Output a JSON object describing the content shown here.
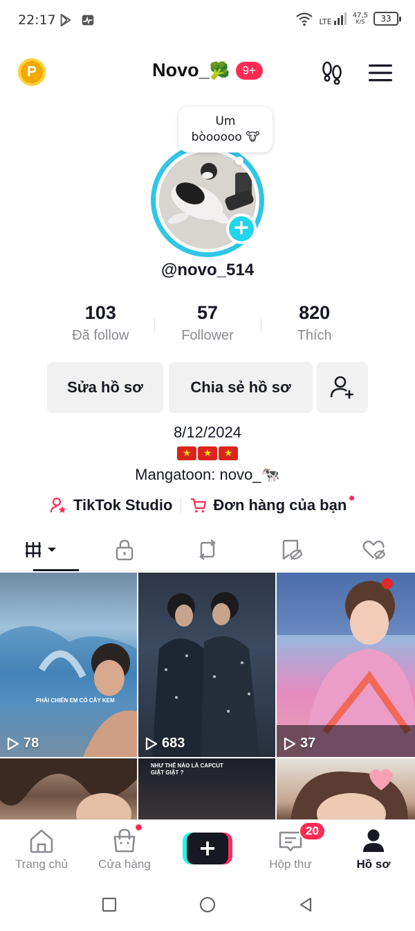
{
  "status_bar": {
    "time": "22:17",
    "network_type": "LTE",
    "net_speed_value": "47,5",
    "net_speed_unit": "K/S",
    "battery": "33"
  },
  "header": {
    "coin_label": "P",
    "profile_name": "Novo_",
    "name_emoji": "🥦",
    "notification_badge": "9+"
  },
  "note": {
    "line1": "Um",
    "line2": "bòooooo 🐮"
  },
  "profile": {
    "username": "@novo_514",
    "add_label": "+"
  },
  "stats": [
    {
      "value": "103",
      "label": "Đã follow"
    },
    {
      "value": "57",
      "label": "Follower"
    },
    {
      "value": "820",
      "label": "Thích"
    }
  ],
  "buttons": {
    "edit": "Sửa hồ sơ",
    "share": "Chia sẻ hồ sơ"
  },
  "bio": {
    "date": "8/12/2024",
    "flags": [
      "★",
      "★",
      "★"
    ],
    "text": "Mangatoon: novo_🐄"
  },
  "links": {
    "studio": "TikTok Studio",
    "orders": "Đơn hàng của bạn"
  },
  "videos": [
    {
      "views": "78",
      "caption": "PHẢI CHIẾN EM CÓ CÂY KEM"
    },
    {
      "views": "683",
      "caption": ""
    },
    {
      "views": "37",
      "caption": ""
    },
    {
      "views": "",
      "caption": ""
    },
    {
      "views": "",
      "caption": "NHƯ THẾ NÀO LÀ CAPCUT GIẬT GIẬT ?"
    },
    {
      "views": "",
      "caption": ""
    }
  ],
  "bottom_nav": {
    "home": "Trang chủ",
    "shop": "Cửa hàng",
    "create": "+",
    "inbox": "Hộp thư",
    "inbox_badge": "20",
    "profile": "Hồ sơ"
  },
  "colors": {
    "accent_red": "#fe2c55",
    "accent_cyan": "#25f4ee",
    "avatar_ring": "#2fc6e7"
  }
}
